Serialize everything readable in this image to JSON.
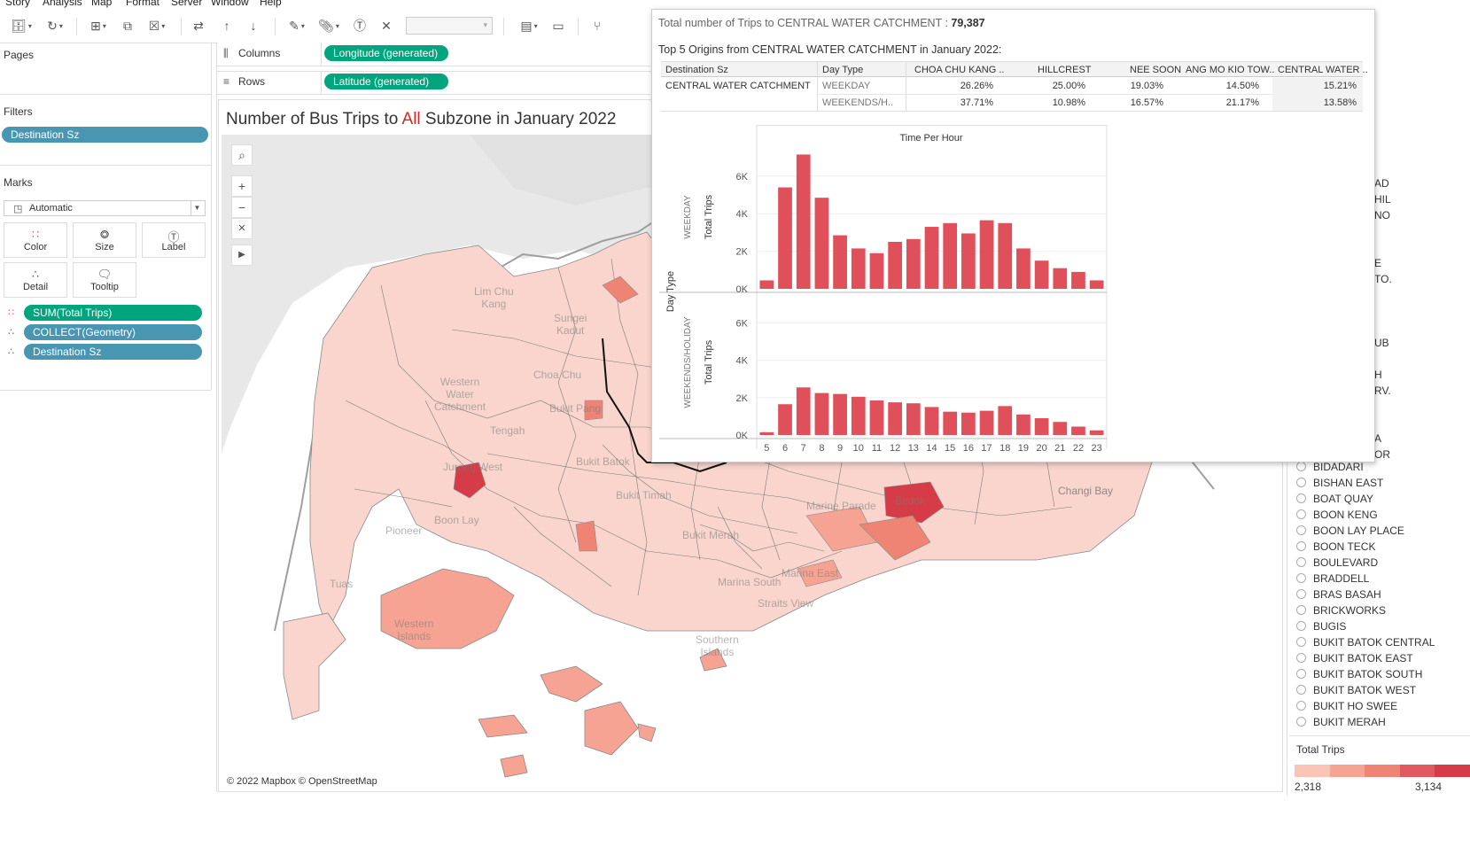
{
  "menu": [
    "Story",
    "Analysis",
    "Map",
    "Format",
    "Server",
    "Window",
    "Help"
  ],
  "left_panel": {
    "pages_label": "Pages",
    "filters_label": "Filters",
    "filter_pill": "Destination Sz",
    "marks_label": "Marks",
    "marks_type": "Automatic",
    "buttons": {
      "color": "Color",
      "size": "Size",
      "label": "Label",
      "detail": "Detail",
      "tooltip": "Tooltip"
    },
    "mark_fields": [
      "SUM(Total Trips)",
      "COLLECT(Geometry)",
      "Destination Sz"
    ]
  },
  "shelves": {
    "columns_label": "Columns",
    "columns_pill": "Longitude (generated)",
    "rows_label": "Rows",
    "rows_pill": "Latitude (generated)"
  },
  "sheet": {
    "title_prefix": "Number of Bus Trips to ",
    "title_highlight": "All",
    "title_suffix": " Subzone in January 2022"
  },
  "map": {
    "labels": [
      "Lim Chu\nKang",
      "Sungei\nKadut",
      "Western\nWater\nCatchment",
      "Tengah",
      "Choa Chu",
      "Bukit Pang",
      "Bukit Batok",
      "Jurong West",
      "Pioneer",
      "Boon Lay",
      "Tuas",
      "Western\nIslands",
      "Bukit Timah",
      "Bedok",
      "Changi Bay",
      "Marine Parade",
      "Southern\nIslands",
      "Bukit Merah",
      "Marina East",
      "Straits View",
      "Marina South"
    ],
    "attribution": "© 2022 Mapbox © OpenStreetMap"
  },
  "right_list": {
    "partial_items": [
      "AD",
      "HIL",
      "NO",
      "E",
      "TO.",
      "UB",
      "H",
      "RV.",
      "A",
      "OR"
    ],
    "items": [
      "BIDADARI",
      "BISHAN EAST",
      "BOAT QUAY",
      "BOON KENG",
      "BOON LAY PLACE",
      "BOON TECK",
      "BOULEVARD",
      "BRADDELL",
      "BRAS BASAH",
      "BRICKWORKS",
      "BUGIS",
      "BUKIT BATOK CENTRAL",
      "BUKIT BATOK EAST",
      "BUKIT BATOK SOUTH",
      "BUKIT BATOK WEST",
      "BUKIT HO SWEE",
      "BUKIT MERAH"
    ]
  },
  "color_legend": {
    "title": "Total Trips",
    "min": "2,318",
    "max": "3,134",
    "colors": [
      "#fbc3b6",
      "#f6a393",
      "#ef8474",
      "#e05a5d",
      "#d63c48"
    ]
  },
  "tooltip": {
    "total_label": "Total number of Trips to  CENTRAL WATER CATCHMENT  : ",
    "total_value": "79,387",
    "top5_label": "Top 5 Origins from  CENTRAL WATER CATCHMENT in January 2022:",
    "table": {
      "headers": [
        "Destination Sz",
        "Day Type",
        "CHOA CHU KANG ..",
        "HILLCREST",
        "NEE SOON",
        "ANG MO KIO TOW..",
        "CENTRAL WATER .."
      ],
      "dest": "CENTRAL WATER CATCHMENT",
      "rows": [
        {
          "day_type": "WEEKDAY",
          "values": [
            "26.26%",
            "25.00%",
            "19.03%",
            "14.50%",
            "15.21%"
          ]
        },
        {
          "day_type": "WEEKENDS/H..",
          "values": [
            "37.71%",
            "10.98%",
            "16.57%",
            "21.17%",
            "13.58%"
          ]
        }
      ]
    }
  },
  "chart_data": {
    "type": "bar",
    "title": "Time Per Hour",
    "row_axis_label": "Day Type",
    "ylabel": "Total Trips",
    "categories": [
      "5",
      "6",
      "7",
      "8",
      "9",
      "10",
      "11",
      "12",
      "13",
      "14",
      "15",
      "16",
      "17",
      "18",
      "19",
      "20",
      "21",
      "22",
      "23"
    ],
    "ylim": [
      0,
      7500
    ],
    "yticks": [
      0,
      2000,
      4000,
      6000
    ],
    "ytick_labels": [
      "0K",
      "2K",
      "4K",
      "6K"
    ],
    "bar_color": "#e0505a",
    "series": [
      {
        "name": "WEEKDAY",
        "values": [
          450,
          5400,
          7150,
          4850,
          2850,
          2150,
          1900,
          2500,
          2650,
          3300,
          3500,
          2950,
          3650,
          3500,
          2150,
          1500,
          1100,
          900,
          450
        ]
      },
      {
        "name": "WEEKENDS/HOLIDAY",
        "values": [
          150,
          1650,
          2550,
          2250,
          2200,
          2050,
          1850,
          1750,
          1700,
          1500,
          1250,
          1200,
          1300,
          1550,
          1100,
          900,
          700,
          450,
          250
        ]
      }
    ]
  }
}
